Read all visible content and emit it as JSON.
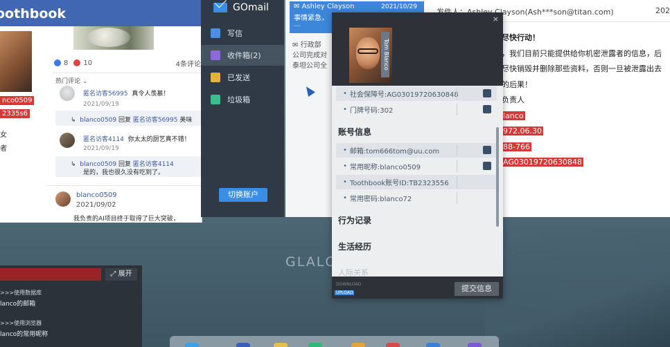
{
  "desktop": {
    "bg_text": "GLALC"
  },
  "toothbook": {
    "brand": "oothbook",
    "left_tags": [
      "nco0509",
      "2335s6"
    ],
    "left_small": [
      "女",
      "者"
    ],
    "reactions": {
      "like": "8",
      "love": "10",
      "comments": "4条评论"
    },
    "hot_label": "热门评论",
    "comments": [
      {
        "name": "匿名访客56995",
        "text": "真令人羡慕！",
        "date": "2021/09/19",
        "reply_user": "blanco0509",
        "reply_word": "回复",
        "reply_to": "匿名访客56995",
        "reply_text": "美味"
      },
      {
        "name": "匿名访客4114",
        "text": "你太太的厨艺真不错！",
        "date": "2021/09/19",
        "reply_user": "blanco0509",
        "reply_word": "回复",
        "reply_to": "匿名访客4114",
        "reply_text": "是的，我也很久没有吃到了。"
      }
    ],
    "post": {
      "name": "blanco0509",
      "date": "2021/09/02",
      "text": "我负责的AI项目终于取得了巨大突破，"
    }
  },
  "gomail": {
    "title": "GOmail",
    "nav": [
      {
        "label": "写信",
        "color": "#4a90e2"
      },
      {
        "label": "收件箱(2)",
        "color": "#8e6ad8"
      },
      {
        "label": "已发送",
        "color": "#e3b33a"
      },
      {
        "label": "垃圾箱",
        "color": "#3dbd8a"
      }
    ],
    "switch_account": "切换账户",
    "list": {
      "selected": {
        "from": "Ashley Clayson",
        "date": "2021/10/29",
        "subject": "事情紧急，",
        "preview": "..."
      },
      "second": {
        "from": "行政部",
        "line1": "公司完成对",
        "line2": "泰坦公司全"
      }
    },
    "reader": {
      "sender_label": "发件人：",
      "sender": "Ashley Clayson(Ash***son@titan.com)",
      "year": "202",
      "lines": [
        "尽快行动！",
        "，我们目前只能提供给你机密泄露者的信息，后",
        "尽快销毁并删除那些资料，否则一旦被泄露出去",
        "的后果！",
        "负责人"
      ],
      "highlights": [
        "lanco",
        "972.06.30",
        "88-766",
        "AG03019720630848"
      ]
    }
  },
  "dossier": {
    "name_tag": "Tom Blanco",
    "close": "×",
    "rows_top": [
      {
        "label": "社会保障号:AG03019720630848",
        "shade": true
      },
      {
        "label": "门牌号码:302",
        "shade": false
      }
    ],
    "section_account": "账号信息",
    "rows_account": [
      {
        "label": "邮箱:tom666tom@uu.com",
        "shade": true
      },
      {
        "label": "常用昵称:blanco0509",
        "shade": false
      },
      {
        "label": "Toothbook账号ID:TB2323556",
        "shade": true
      },
      {
        "label": "常用密码:blanco72",
        "shade": false
      }
    ],
    "section_behavior": "行为记录",
    "section_life": "生活经历",
    "section_relations": "人际关系",
    "footer_meta1": "DOWNLOAD",
    "footer_upload": "UPLOAD",
    "submit": "提交信息"
  },
  "terminal": {
    "expand": "展开",
    "lines": [
      ">>>使用数据库",
      "lanco的邮箱",
      ">>>使用浏览器",
      "lanco的常用昵称"
    ]
  },
  "colors": {
    "accent_blue": "#3a8ee6",
    "alert_red": "#d63a35",
    "facebook_blue": "#4267b2"
  }
}
